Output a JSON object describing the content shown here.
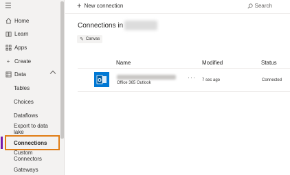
{
  "sidebar": {
    "items": [
      {
        "label": "Home",
        "icon": "home-icon"
      },
      {
        "label": "Learn",
        "icon": "book-icon"
      },
      {
        "label": "Apps",
        "icon": "apps-grid-icon"
      },
      {
        "label": "Create",
        "icon": "plus-icon"
      },
      {
        "label": "Data",
        "icon": "table-icon",
        "expanded": true
      }
    ],
    "subitems": [
      {
        "label": "Tables"
      },
      {
        "label": "Choices"
      },
      {
        "label": "Dataflows"
      },
      {
        "label": "Export to data lake"
      },
      {
        "label": "Connections",
        "selected": true
      },
      {
        "label": "Custom Connectors"
      },
      {
        "label": "Gateways"
      }
    ]
  },
  "toolbar": {
    "new_connection_label": "New connection",
    "search_label": "Search"
  },
  "page": {
    "title": "Connections in",
    "filter_chip": "Canvas"
  },
  "table": {
    "columns": [
      "Name",
      "Modified",
      "Status"
    ],
    "rows": [
      {
        "type": "Office 365 Outlook",
        "more": "···",
        "modified": "7 sec ago",
        "status": "Connected"
      }
    ]
  },
  "colors": {
    "accent": "#7719aa",
    "highlight": "#e07c14",
    "outlook_blue": "#0078d4"
  }
}
